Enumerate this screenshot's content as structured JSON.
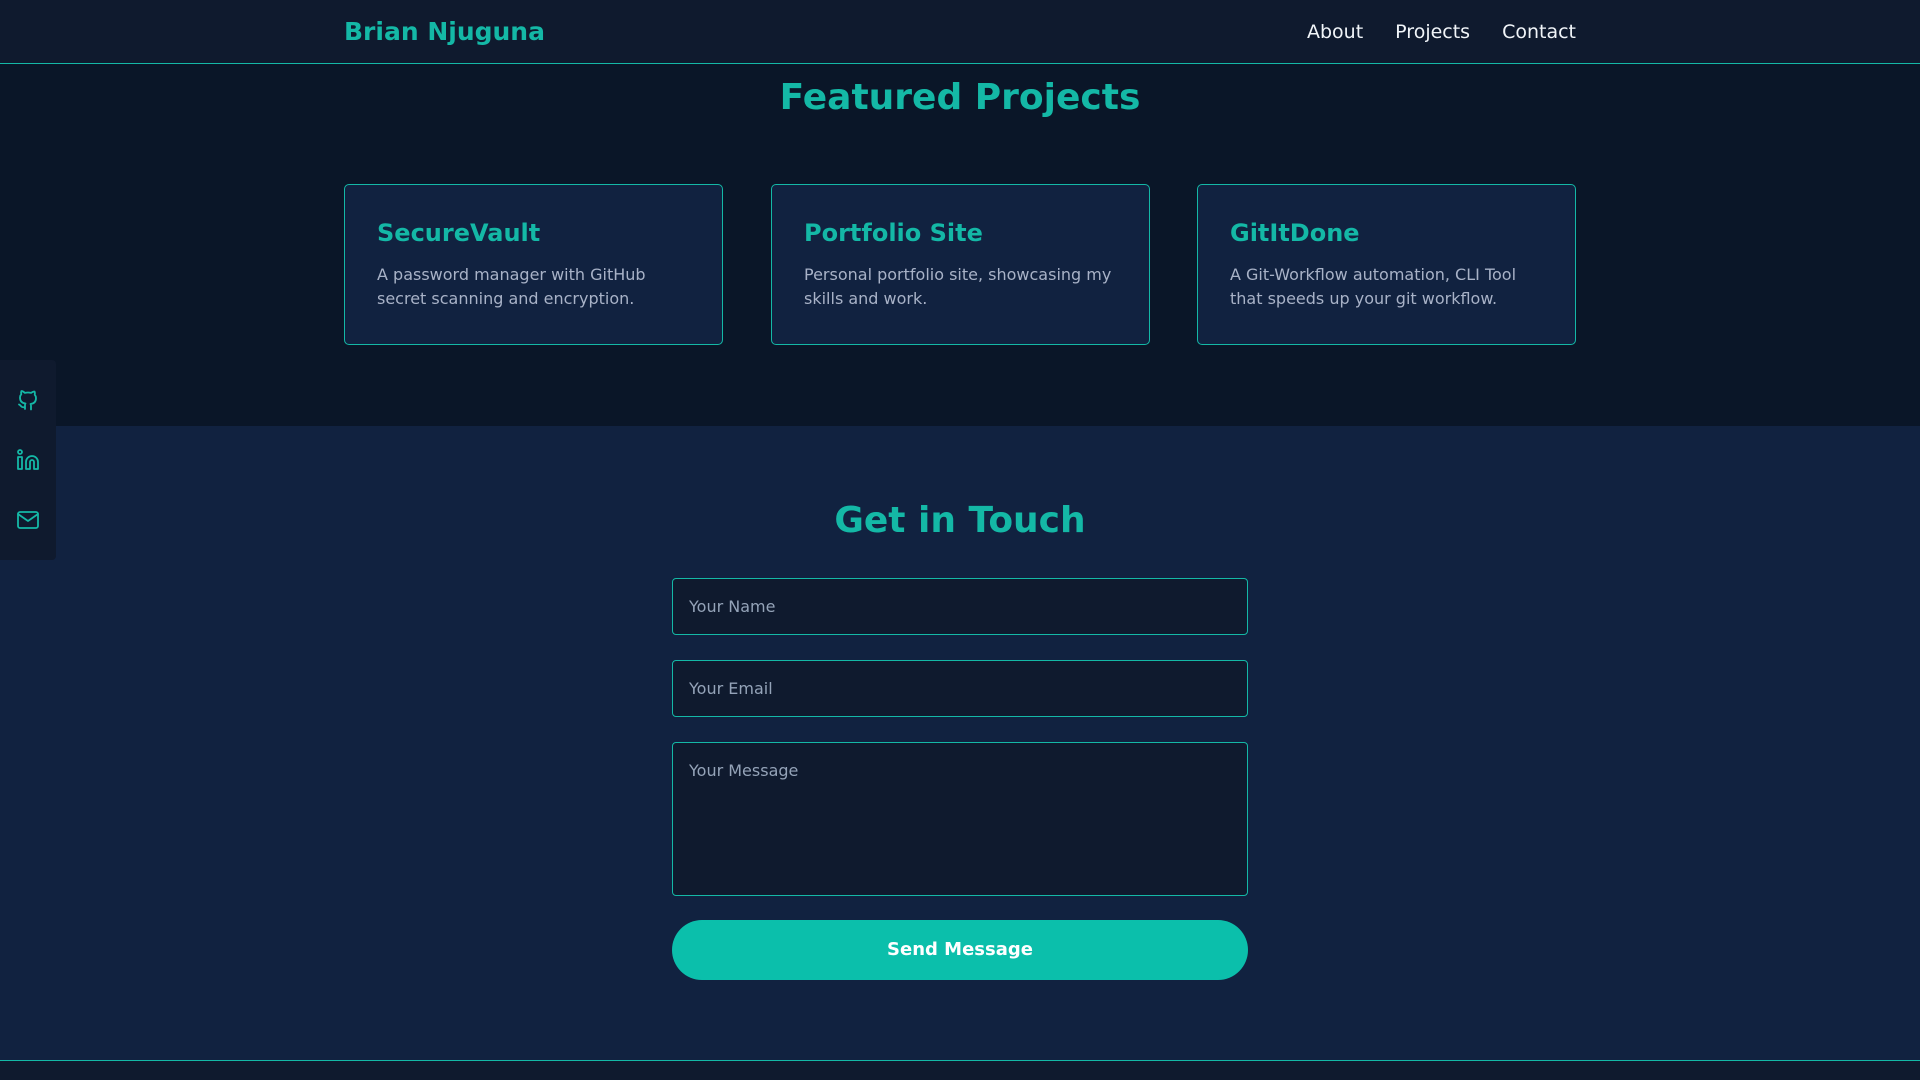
{
  "header": {
    "brand": "Brian Njuguna",
    "nav": [
      {
        "label": "About"
      },
      {
        "label": "Projects"
      },
      {
        "label": "Contact"
      }
    ]
  },
  "projects": {
    "title": "Featured Projects",
    "cards": [
      {
        "title": "SecureVault",
        "description": "A password manager with GitHub secret scanning and encryption."
      },
      {
        "title": "Portfolio Site",
        "description": "Personal portfolio site, showcasing my skills and work."
      },
      {
        "title": "GitItDone",
        "description": "A Git-Workflow automation, CLI Tool that speeds up your git workflow."
      }
    ]
  },
  "social": {
    "icons": [
      "github-icon",
      "linkedin-icon",
      "mail-icon"
    ]
  },
  "contact": {
    "title": "Get in Touch",
    "name_placeholder": "Your Name",
    "email_placeholder": "Your Email",
    "message_placeholder": "Your Message",
    "send_label": "Send Message"
  },
  "colors": {
    "accent": "#14b8a6",
    "background": "#0a1628",
    "surface": "#112240",
    "header": "#0f1a2e"
  }
}
